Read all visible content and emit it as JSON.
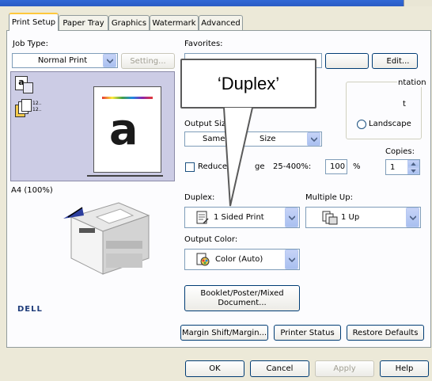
{
  "tabs": [
    "Print Setup",
    "Paper Tray",
    "Graphics",
    "Watermark",
    "Advanced"
  ],
  "job_type": {
    "label": "Job Type:",
    "value": "Normal Print",
    "setting_button": "Setting..."
  },
  "favorites": {
    "label": "Favorites:",
    "edit_button": "Edit..."
  },
  "callout": "‘Duplex’",
  "orientation": {
    "label": "ntation",
    "portrait_label": "t",
    "landscape_label": "Landscape"
  },
  "output_size": {
    "label": "Output Siz",
    "value_left": "Same",
    "value_right": "Size"
  },
  "reduce": {
    "label_left": "Reduce",
    "label_right": "ge",
    "range": "25-400%:",
    "value": "100",
    "unit": "%"
  },
  "copies": {
    "label": "Copies:",
    "value": "1"
  },
  "paper_caption": "A4 (100%)",
  "preview_icons": {
    "label_a": "a",
    "label_b": "12.."
  },
  "paper_letter": "a",
  "duplex": {
    "label": "Duplex:",
    "value": "1 Sided Print"
  },
  "multiple_up": {
    "label": "Multiple Up:",
    "value": "1 Up"
  },
  "output_color": {
    "label": "Output Color:",
    "value": "Color (Auto)"
  },
  "booklet_button": "Booklet/Poster/Mixed Document...",
  "brand": "DELL",
  "bottom_buttons": {
    "margin": "Margin Shift/Margin...",
    "status": "Printer Status",
    "restore": "Restore Defaults"
  },
  "dialog_buttons": {
    "ok": "OK",
    "cancel": "Cancel",
    "apply": "Apply",
    "help": "Help"
  }
}
